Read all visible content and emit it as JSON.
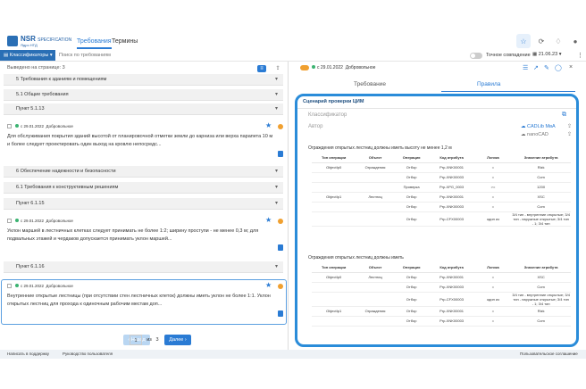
{
  "header": {
    "logo_title": "NSR",
    "logo_title_small": "SPECIFICATION",
    "logo_subtitle": "Ядро НТД",
    "tabs": [
      {
        "label": "Требования",
        "active": true
      },
      {
        "label": "Термины",
        "active": false
      }
    ]
  },
  "toolbar": {
    "classifiers_label": "Классификаторы",
    "search_placeholder": "Поиск по требованиям",
    "exact_match_label": "Точное совпадение",
    "date": "21.06.23"
  },
  "left": {
    "head": "Выведено на странице: 3",
    "sections": [
      "5 Требования к зданиям и помещениям",
      "5.1 Общие требования",
      "Пункт 5.1.13",
      "6 Обеспечение надежности и безопасности",
      "6.1 Требования к конструктивным решениям",
      "Пункт 6.1.15",
      "Пункт 6.1.16"
    ],
    "items": [
      {
        "date": "с 29.01.2022",
        "status": "Добровольное",
        "text": "Для обслуживания покрытия зданий высотой от планировочной отметки земли до карниза или верха парапета 10 м и более следует проектировать один выход на кровлю непосредс..."
      },
      {
        "date": "с 29.01.2022",
        "status": "Добровольное",
        "text": "Уклон маршей в лестничных клетках следует принимать не более 1:2; ширину проступи - не менее 0,3 м; для подвальных этажей и чердаков допускается принимать уклон маршей..."
      },
      {
        "date": "с 29.01.2022",
        "status": "Добровольное",
        "text": "Внутренние открытые лестницы (при отсутствии стен лестничных клеток) должны иметь уклон не более 1:1. Уклон открытых лестниц для прохода к одиночным рабочим местам доп..."
      }
    ],
    "pager": {
      "prev": "Назад",
      "page": "1",
      "of": "из",
      "total": "3",
      "next": "Далее"
    }
  },
  "right": {
    "status_date": "с 29.01.2022",
    "status": "Добровольное",
    "tabs": [
      {
        "label": "Требование",
        "active": false
      },
      {
        "label": "Правила",
        "active": true
      }
    ],
    "scenario_title": "Сценарий проверки ЦИМ",
    "classifier_placeholder": "Классификатор",
    "author_placeholder": "Автор",
    "cadlib_label": "CADLib МвА",
    "nanocad_label": "nanoCAD",
    "blocks": [
      {
        "title": "Ограждения открытых лестниц должны иметь высоту не менее 1,2 м",
        "headers": [
          "Тип операции",
          "Объект",
          "Операция",
          "Код атрибута",
          "Логика",
          "Значение атрибута"
        ],
        "rows": [
          [
            "ObjectIp0",
            "Ограждения",
            "Отбор",
            "Prp-XNK00001",
            "=",
            "Rlzk"
          ],
          [
            "",
            "",
            "Отбор",
            "Prp-XNK00003",
            "=",
            "Com"
          ],
          [
            "",
            "",
            "Проверка",
            "Prp-XPG_0003",
            ">=",
            "1200"
          ],
          [
            "ObjectIp1",
            "Лестниц",
            "Отбор",
            "Prp-XNK00001",
            "=",
            "XSC"
          ],
          [
            "",
            "",
            "Отбор",
            "Prp-XNK00003",
            "=",
            "Com"
          ],
          [
            "",
            "",
            "Отбор",
            "Prp-CFX00003",
            "один из",
            "3/4 тип - внутренние открытые; 3/4 тип - наружные открытые; 3/4 тип - 1; 3/4 тип"
          ]
        ]
      },
      {
        "title": "Ограждения открытых лестниц должны иметь",
        "headers": [
          "Тип операции",
          "Объект",
          "Операция",
          "Код атрибута",
          "Логика",
          "Значение атрибута"
        ],
        "rows": [
          [
            "ObjectIp0",
            "Лестниц",
            "Отбор",
            "Prp-XNK00001",
            "=",
            "XSC"
          ],
          [
            "",
            "",
            "Отбор",
            "Prp-XNK00003",
            "=",
            "Com"
          ],
          [
            "",
            "",
            "Отбор",
            "Prp-CFX00003",
            "один из",
            "3/4 тип - внутренние открытые; 3/4 тип - наружные открытые; 3/4 тип - 1; 3/4 тип"
          ],
          [
            "ObjectIp1",
            "Ограждения",
            "Отбор",
            "Prp-XNK00001",
            "=",
            "Rlzk"
          ],
          [
            "",
            "",
            "Отбор",
            "Prp-XNK00003",
            "=",
            "Com"
          ]
        ]
      }
    ]
  },
  "footer": {
    "support": "Написать в поддержку",
    "manual": "Руководство пользователя",
    "right": "Пользовательское соглашение"
  },
  "colors": {
    "accent": "#2a7bd4",
    "brand": "#2a6fb5",
    "highlight_border": "#2a8cd9",
    "status_ok": "#3cb371",
    "warn": "#f0a030"
  }
}
